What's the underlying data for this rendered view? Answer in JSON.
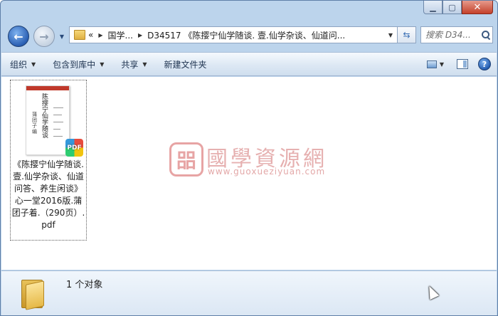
{
  "navigation": {
    "breadcrumb_overflow": "«",
    "breadcrumb": [
      "国学...",
      "D34517 《陈撄宁仙学随谈. 壹.仙学杂谈、仙道问..."
    ],
    "search_placeholder": "搜索 D34..."
  },
  "toolbar": {
    "organize": "组织",
    "include_in_library": "包含到库中",
    "share": "共享",
    "new_folder": "新建文件夹",
    "help": "?"
  },
  "files": [
    {
      "name": "《陈撄宁仙学随谈. 壹.仙学杂谈、仙道问答、养生闲谈》心一堂2016版.蒲团子着.（290页）.pdf",
      "type_badge": "PDF",
      "icon": "pdf-file-icon",
      "thumbnail_title": "陈撄宁仙学随谈",
      "thumbnail_author": "蒲团子编",
      "thumbnail_band_color": "#c0392b"
    }
  ],
  "watermark": {
    "seal_char": "㗊",
    "title": "國學資源網",
    "url": "www.guoxueziyuan.com"
  },
  "status": {
    "item_count": "1 个对象"
  },
  "colors": {
    "frame": "#bcd4ec",
    "command_bar": "#dde8f4",
    "close_button": "#c4412b",
    "watermark": "#c85050"
  }
}
